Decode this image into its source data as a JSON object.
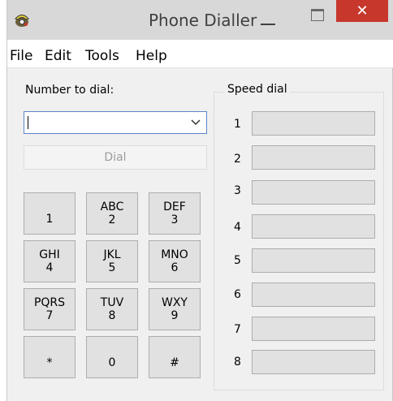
{
  "window": {
    "title": "Phone Dialler",
    "close_label": "✕"
  },
  "menu": [
    "File",
    "Edit",
    "Tools",
    "Help"
  ],
  "dial": {
    "label": "Number to dial:",
    "value": "",
    "button_label": "Dial"
  },
  "keypad": [
    {
      "letters": "",
      "digit": "1"
    },
    {
      "letters": "ABC",
      "digit": "2"
    },
    {
      "letters": "DEF",
      "digit": "3"
    },
    {
      "letters": "GHI",
      "digit": "4"
    },
    {
      "letters": "JKL",
      "digit": "5"
    },
    {
      "letters": "MNO",
      "digit": "6"
    },
    {
      "letters": "PQRS",
      "digit": "7"
    },
    {
      "letters": "TUV",
      "digit": "8"
    },
    {
      "letters": "WXY",
      "digit": "9"
    },
    {
      "letters": "",
      "digit": "*"
    },
    {
      "letters": "",
      "digit": "0"
    },
    {
      "letters": "",
      "digit": "#"
    }
  ],
  "speed_dial": {
    "label": "Speed dial",
    "entries": [
      {
        "number": "1",
        "value": ""
      },
      {
        "number": "2",
        "value": ""
      },
      {
        "number": "3",
        "value": ""
      },
      {
        "number": "4",
        "value": ""
      },
      {
        "number": "5",
        "value": ""
      },
      {
        "number": "6",
        "value": ""
      },
      {
        "number": "7",
        "value": ""
      },
      {
        "number": "8",
        "value": ""
      }
    ]
  },
  "colors": {
    "close": "#c7372c",
    "input_border": "#5a86c7",
    "button_face": "#e1e1e1"
  },
  "icons": [
    "phone-app-icon",
    "minimize-icon",
    "maximize-icon",
    "close-icon",
    "chevron-down-icon"
  ]
}
